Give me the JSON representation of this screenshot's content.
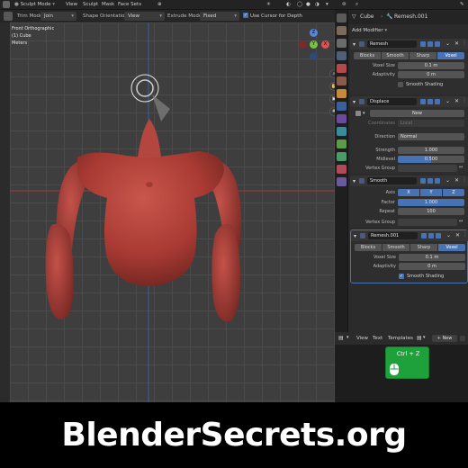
{
  "header": {
    "mode": "Sculpt Mode",
    "menus": [
      "View",
      "Sculpt",
      "Mask",
      "Face Sets"
    ]
  },
  "toolbar": {
    "trim_mode_label": "Trim Mode:",
    "trim_mode_value": "Join",
    "shape_orientation_label": "Shape Orientation:",
    "shape_orientation_value": "View",
    "extrude_mode_label": "Extrude Mode:",
    "extrude_mode_value": "Fixed",
    "use_cursor_label": "Use Cursor for Depth"
  },
  "viewport": {
    "view_name": "Front Orthographic",
    "object_info": "(1) Cube",
    "units": "Meters",
    "gizmo": {
      "x": "X",
      "y": "Y",
      "z": "Z"
    }
  },
  "props": {
    "object": "Cube",
    "modifier_ref": "Remesh.001",
    "add_modifier": "Add Modifier",
    "remesh1": {
      "name": "Remesh",
      "modes": [
        "Blocks",
        "Smooth",
        "Sharp",
        "Voxel"
      ],
      "active_mode": 3,
      "voxel_size_label": "Voxel Size",
      "voxel_size": "0.1 m",
      "adaptivity_label": "Adaptivity",
      "adaptivity": "0 m",
      "smooth_shading_label": "Smooth Shading"
    },
    "displace": {
      "name": "Displace",
      "new_label": "New",
      "coordinates_label": "Coordinates",
      "coordinates": "Local",
      "direction_label": "Direction",
      "direction": "Normal",
      "strength_label": "Strength",
      "strength": "1.000",
      "midlevel_label": "Midlevel",
      "midlevel": "0.500",
      "vertex_group_label": "Vertex Group"
    },
    "smooth": {
      "name": "Smooth",
      "axis_label": "Axis",
      "axes": [
        "X",
        "Y",
        "Z"
      ],
      "factor_label": "Factor",
      "factor": "1.000",
      "repeat_label": "Repeat",
      "repeat": "100",
      "vertex_group_label": "Vertex Group"
    },
    "remesh2": {
      "name": "Remesh.001",
      "modes": [
        "Blocks",
        "Smooth",
        "Sharp",
        "Voxel"
      ],
      "voxel_size_label": "Voxel Size",
      "voxel_size": "0.1 m",
      "adaptivity_label": "Adaptivity",
      "adaptivity": "0 m",
      "smooth_shading_label": "Smooth Shading"
    }
  },
  "text_editor": {
    "menus": [
      "View",
      "Text",
      "Templates"
    ],
    "new_label": "New"
  },
  "key_popup": {
    "keys": "Ctrl + Z"
  },
  "banner": {
    "text": "BlenderSecrets.org"
  },
  "colors": {
    "accent": "#4772b3",
    "mesh": "#b5443c",
    "key_popup": "#1ea13b"
  }
}
